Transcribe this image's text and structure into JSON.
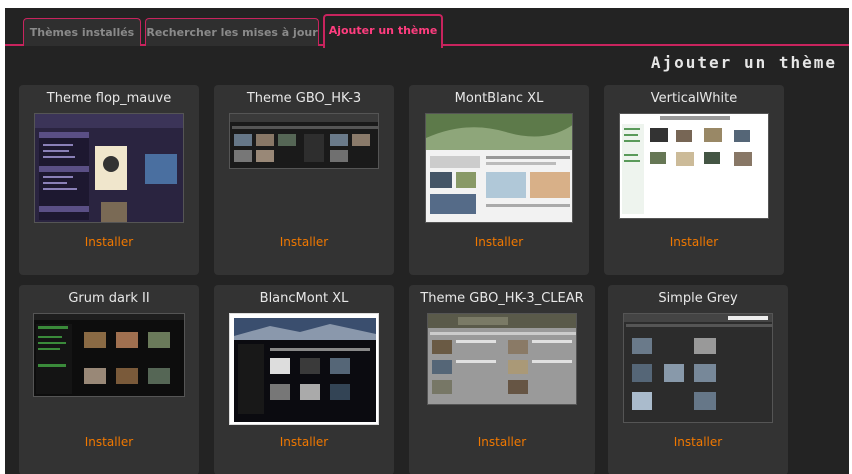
{
  "tabs": [
    {
      "label": "Thèmes installés"
    },
    {
      "label": "Rechercher les mises à jour"
    },
    {
      "label": "Ajouter un thème"
    }
  ],
  "page_title": "Ajouter un thème",
  "themes": [
    {
      "name": "Theme flop_mauve",
      "action": "Installer"
    },
    {
      "name": "Theme GBO_HK-3",
      "action": "Installer"
    },
    {
      "name": "MontBlanc XL",
      "action": "Installer"
    },
    {
      "name": "VerticalWhite",
      "action": "Installer"
    },
    {
      "name": "Grum dark II",
      "action": "Installer"
    },
    {
      "name": "BlancMont XL",
      "action": "Installer"
    },
    {
      "name": "Theme GBO_HK-3_CLEAR",
      "action": "Installer"
    },
    {
      "name": "Simple Grey",
      "action": "Installer"
    }
  ],
  "colors": {
    "accent": "#c8245e",
    "active_tab_text": "#ff3d7f",
    "install_link": "#f07800",
    "background": "#232323",
    "card": "#333333"
  }
}
